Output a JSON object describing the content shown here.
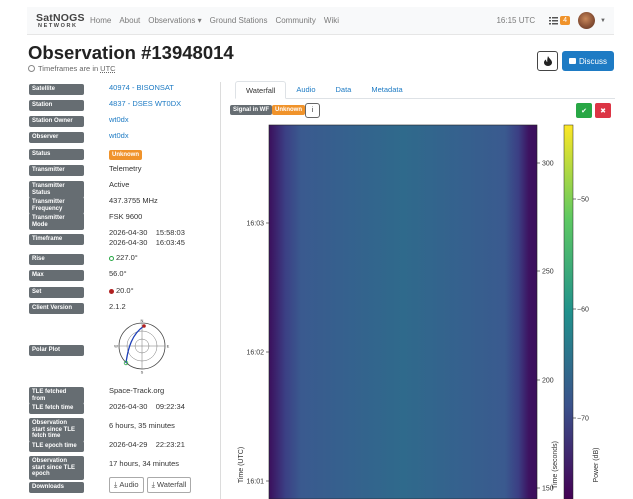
{
  "nav": {
    "logo_top": "SatNOGS",
    "logo_bottom": "NETWORK",
    "links": [
      "Home",
      "About",
      "Observations ▾",
      "Ground Stations",
      "Community",
      "Wiki"
    ],
    "time": "16:15 UTC",
    "notification_count": "4"
  },
  "header": {
    "title": "Observation #13948014",
    "subtitle_prefix": "Timeframes are in",
    "subtitle_tz": "UTC",
    "discuss_label": "Discuss"
  },
  "details": {
    "satellite_label": "Satellite",
    "satellite": "40974 - BISONSAT",
    "station_label": "Station",
    "station": "4837 - DSES WT0DX",
    "station_owner_label": "Station Owner",
    "station_owner": "wt0dx",
    "observer_label": "Observer",
    "observer": "wt0dx",
    "status_label": "Status",
    "status": "Unknown",
    "transmitter_label": "Transmitter",
    "transmitter": "Telemetry",
    "transmitter_status_label": "Transmitter Status",
    "transmitter_status": "Active",
    "transmitter_frequency_label": "Transmitter Frequency",
    "transmitter_frequency": "437.3755 MHz",
    "transmitter_mode_label": "Transmitter Mode",
    "transmitter_mode": "FSK 9600",
    "timeframe_label": "Timeframe",
    "timeframe_start": "2026-04-30    15:58:03",
    "timeframe_end": "2026-04-30    16:03:45",
    "rise_label": "Rise",
    "rise": "227.0°",
    "max_label": "Max",
    "max": "56.0°",
    "set_label": "Set",
    "set": "20.0°",
    "client_version_label": "Client Version",
    "client_version": "2.1.2",
    "polar_plot_label": "Polar Plot",
    "polar": {
      "n": "N",
      "e": "E",
      "s": "S",
      "w": "W"
    },
    "tle_fetched_from_label": "TLE fetched from",
    "tle_fetched_from": "Space-Track.org",
    "tle_fetch_time_label": "TLE fetch time",
    "tle_fetch_time": "2026-04-30    09:22:34",
    "obs_start_since_fetch_label": "Observation start since TLE fetch time",
    "obs_start_since_fetch": "6 hours, 35 minutes",
    "tle_epoch_time_label": "TLE epoch time",
    "tle_epoch_time": "2026-04-29    22:23:21",
    "obs_start_since_epoch_label": "Observation start since TLE epoch",
    "obs_start_since_epoch": "17 hours, 34 minutes",
    "downloads_label": "Downloads",
    "audio_btn": "Audio",
    "waterfall_btn": "Waterfall"
  },
  "tabs": [
    "Waterfall",
    "Audio",
    "Data",
    "Metadata"
  ],
  "waterfall_tools": {
    "signal_badge": "Signal in WF",
    "unknown_badge": "Unknown",
    "info_icon": "i",
    "ok_icon": "✔",
    "no_icon": "✖"
  },
  "chart_data": {
    "type": "heatmap",
    "ylabel_left": "Time (UTC)",
    "ylabel_right": "Time (seconds)",
    "colorbar_label": "Power (dB)",
    "left_ticks": [
      "16:03",
      "16:02",
      "16:01"
    ],
    "right_ticks": [
      "300",
      "250",
      "200",
      "150"
    ],
    "colorbar_ticks": [
      "−50",
      "−60",
      "−70"
    ],
    "colormap": "viridis",
    "colors": {
      "dark": "#3b0f5c",
      "mid": "#3a5a8f",
      "center": "#2c6d8a",
      "edge": "#41b9a0"
    }
  }
}
